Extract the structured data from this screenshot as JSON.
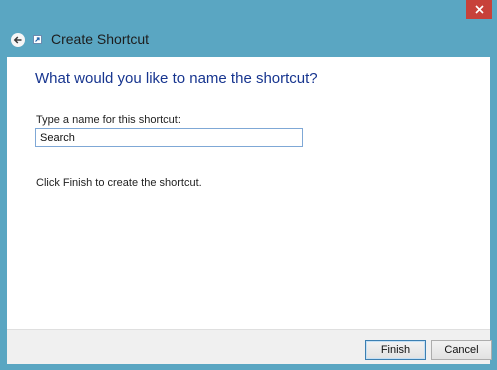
{
  "window": {
    "title": "Create Shortcut"
  },
  "main": {
    "heading": "What would you like to name the shortcut?",
    "name_label": "Type a name for this shortcut:",
    "name_value": "Search",
    "instruction": "Click Finish to create the shortcut."
  },
  "footer": {
    "finish_label": "Finish",
    "cancel_label": "Cancel"
  },
  "icons": {
    "close": "close-icon",
    "back": "back-arrow-icon",
    "shortcut": "shortcut-icon"
  },
  "colors": {
    "frame": "#5aa6c2",
    "close_button": "#c7413a",
    "heading_text": "#17358f",
    "input_border": "#7fa8d6"
  }
}
